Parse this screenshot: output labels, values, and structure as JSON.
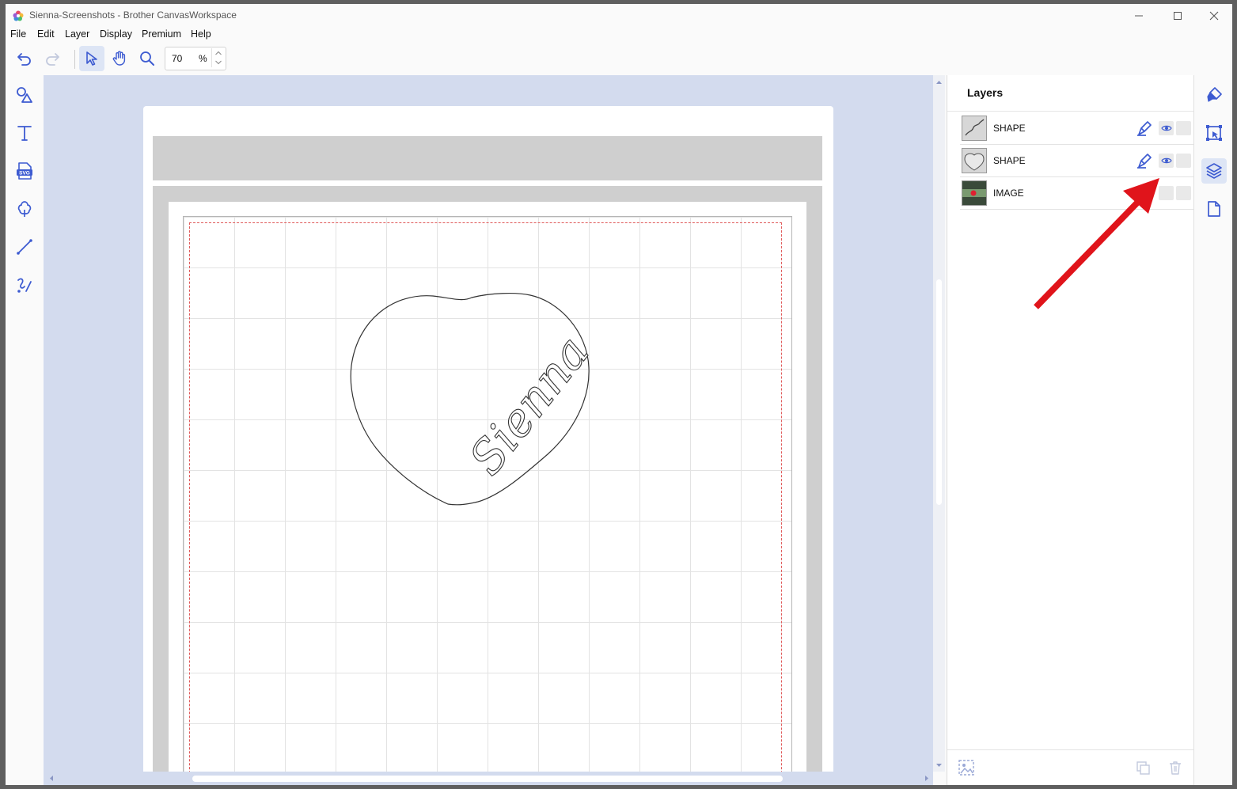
{
  "window": {
    "title": "Sienna-Screenshots - Brother CanvasWorkspace",
    "minimize_icon": "minimize-icon",
    "maximize_icon": "maximize-icon",
    "close_icon": "close-icon"
  },
  "menu": [
    "File",
    "Edit",
    "Layer",
    "Display",
    "Premium",
    "Help"
  ],
  "toolbar": {
    "undo": "undo-icon",
    "redo": "redo-icon",
    "select": "select-arrow-icon",
    "pan": "hand-icon",
    "zoom_tool": "magnifier-icon",
    "zoom_value": "70",
    "zoom_unit": "%"
  },
  "left_tools": [
    "shapes-icon",
    "text-icon",
    "svg-icon",
    "tree-shape-icon",
    "line-icon",
    "freehand-icon"
  ],
  "canvas": {
    "design_text": "Sienna",
    "grid_color": "#e3e3e3",
    "cut_area_color": "#e05a5a"
  },
  "layers_panel": {
    "title": "Layers",
    "layers": [
      {
        "name": "SHAPE",
        "thumb": "sienna-text-thumb",
        "editable": true,
        "visible": true
      },
      {
        "name": "SHAPE",
        "thumb": "heart-thumb",
        "editable": true,
        "visible": true
      },
      {
        "name": "IMAGE",
        "thumb": "photo-thumb",
        "editable": false,
        "visible": false
      }
    ],
    "footer_left": "image-trace-icon",
    "footer_right": [
      "duplicate-icon",
      "trash-icon"
    ]
  },
  "right_tools": [
    "paint-icon",
    "transform-icon",
    "layers-icon",
    "page-icon"
  ],
  "colors": {
    "accent": "#3d5bd1",
    "canvas_bg": "#d3dbee",
    "annotation_arrow": "#e0141b"
  }
}
